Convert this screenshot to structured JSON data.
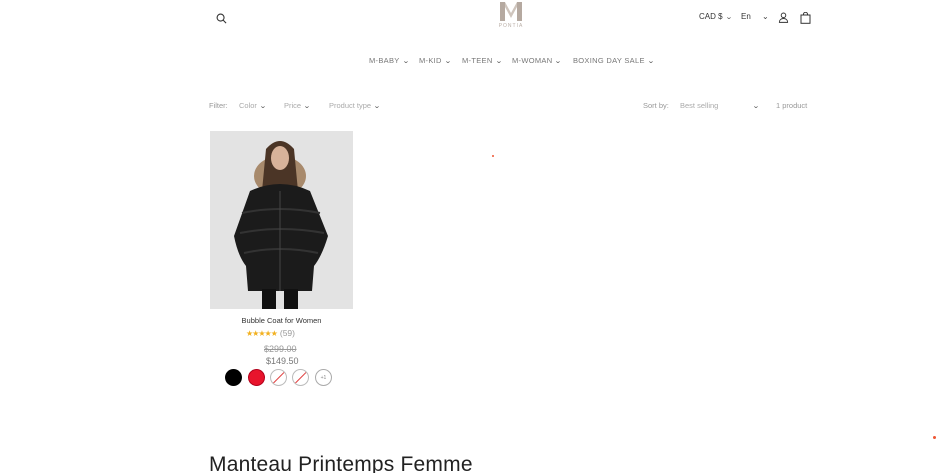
{
  "header": {
    "logo_mark": "M",
    "logo_word": "PONTIA",
    "currency": "CAD $",
    "language": "En"
  },
  "nav": {
    "items": [
      {
        "label": "M-BABY"
      },
      {
        "label": "M-KID"
      },
      {
        "label": "M-TEEN"
      },
      {
        "label": "M-WOMAN"
      },
      {
        "label": "BOXING DAY SALE"
      }
    ]
  },
  "filters": {
    "label": "Filter:",
    "color": "Color",
    "price": "Price",
    "product_type": "Product type",
    "sort_label": "Sort by:",
    "sort_value": "Best selling",
    "count": "1 product"
  },
  "product": {
    "title": "Bubble Coat for Women",
    "stars": "★★★★★",
    "rating_count": "(59)",
    "compare_price": "$299.00",
    "sale_price": "$149.50",
    "swatch_more": "+1",
    "colors": {
      "black": "#000000",
      "red": "#e8142c"
    }
  },
  "collection": {
    "title": "Manteau Printemps Femme"
  }
}
